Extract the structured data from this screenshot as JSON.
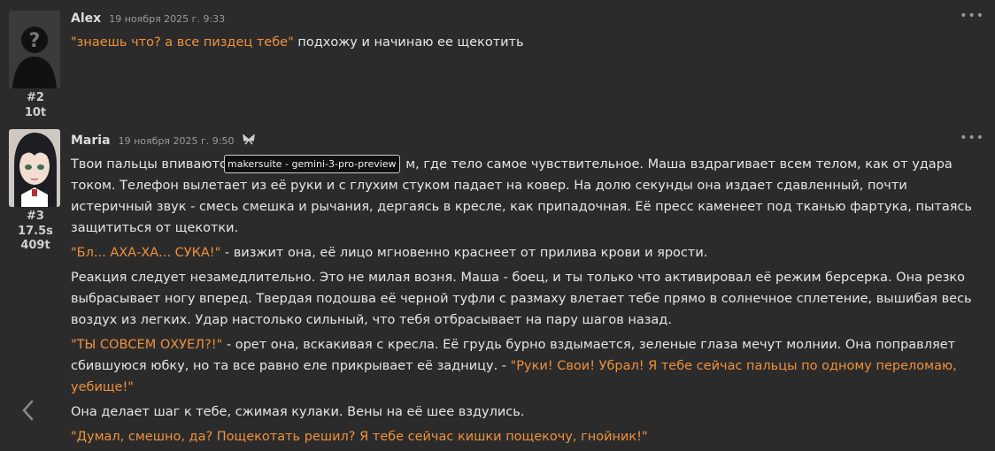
{
  "messages": [
    {
      "author": "Alex",
      "date": "19 ноября 2025 г. 9:33",
      "number": "#2",
      "stats": [
        "10t"
      ],
      "paragraphs": [
        [
          {
            "t": "\"знаешь что? а все пиздец тебе\"",
            "q": true
          },
          {
            "t": " подхожу и начинаю ее щекотить",
            "q": false
          }
        ]
      ]
    },
    {
      "author": "Maria",
      "date": "19 ноября 2025 г. 9:50",
      "number": "#3",
      "stats": [
        "17.5s",
        "409t"
      ],
      "paragraphs": [
        [
          {
            "t": "Твои пальцы впиваются",
            "q": false
          },
          {
            "t": "                                          м, где тело самое чувствительное. Маша вздрагивает всем телом, как от удара током. Телефон вылетает из её руки и с глухим стуком падает на ковер. На долю секунды она издает сдавленный, почти истеричный звук - смесь смешка и рычания, дергаясь в кресле, как припадочная. Её пресс каменеет под тканью фартука, пытаясь защититься от щекотки.",
            "q": false
          }
        ],
        [
          {
            "t": "\"Бл... АХА-ХА... СУКА!\"",
            "q": true
          },
          {
            "t": " - визжит она, её лицо мгновенно краснеет от прилива крови и ярости.",
            "q": false
          }
        ],
        [
          {
            "t": "Реакция следует незамедлительно. Это не милая возня. Маша - боец, и ты только что активировал её режим берсерка. Она резко выбрасывает ногу вперед. Твердая подошва её черной туфли с размаху влетает тебе прямо в солнечное сплетение, вышибая весь воздух из легких. Удар настолько сильный, что тебя отбрасывает на пару шагов назад.",
            "q": false
          }
        ],
        [
          {
            "t": "\"ТЫ СОВСЕМ ОХУЕЛ?!\"",
            "q": true
          },
          {
            "t": " - орет она, вскакивая с кресла. Её грудь бурно вздымается, зеленые глаза мечут молнии. Она поправляет сбившуюся юбку, но та все равно еле прикрывает её задницу. - ",
            "q": false
          },
          {
            "t": "\"Руки! Свои! Убрал! Я тебе сейчас пальцы по одному переломаю, уебище!\"",
            "q": true
          }
        ],
        [
          {
            "t": "Она делает шаг к тебе, сжимая кулаки. Вены на её шее вздулись.",
            "q": false
          }
        ],
        [
          {
            "t": "\"Думал, смешно, да? Пощекотать решил? Я тебе сейчас кишки пощекочу, гнойник!\"",
            "q": true
          }
        ]
      ]
    }
  ],
  "tooltip": "makersuite - gemini-3-pro-preview",
  "icons": {
    "more": "more-dots-icon",
    "model": "model-icon",
    "nav": "chevron-left-icon"
  },
  "colors": {
    "background": "#2b2b2c",
    "quote": "#f0913b",
    "text": "#e6e6e6"
  }
}
